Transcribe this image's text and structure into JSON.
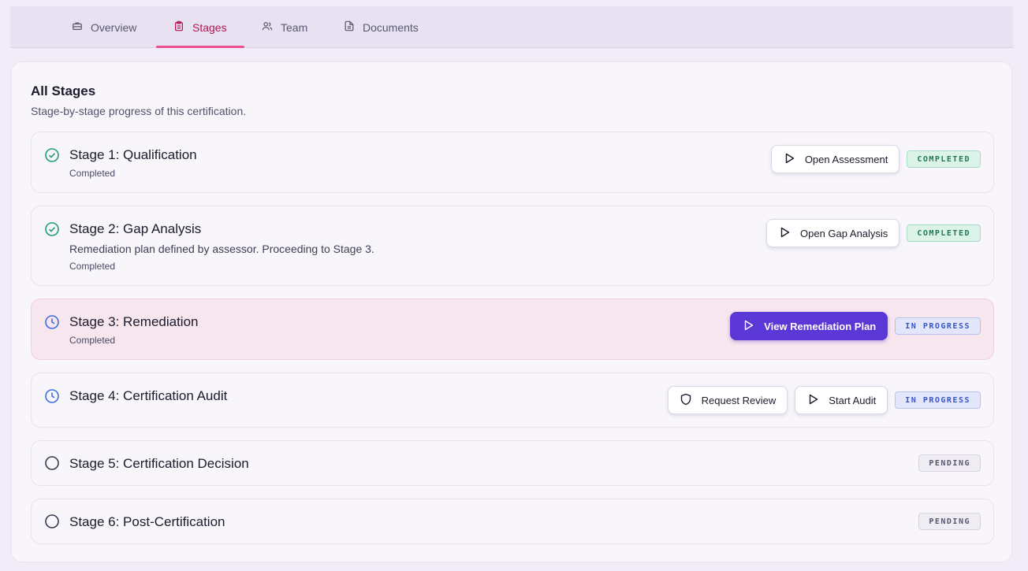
{
  "tabs": [
    {
      "label": "Overview",
      "icon": "briefcase-icon",
      "active": false
    },
    {
      "label": "Stages",
      "icon": "clipboard-icon",
      "active": true
    },
    {
      "label": "Team",
      "icon": "users-icon",
      "active": false
    },
    {
      "label": "Documents",
      "icon": "file-text-icon",
      "active": false
    }
  ],
  "section": {
    "title": "All Stages",
    "subtitle": "Stage-by-stage progress of this certification."
  },
  "stages": [
    {
      "title": "Stage 1: Qualification",
      "description": "",
      "status_text": "Completed",
      "icon": "check-circle-icon",
      "badge": "COMPLETED",
      "actions": [
        {
          "label": "Open Assessment",
          "icon": "play-icon"
        }
      ]
    },
    {
      "title": "Stage 2: Gap Analysis",
      "description": "Remediation plan defined by assessor. Proceeding to Stage 3.",
      "status_text": "Completed",
      "icon": "check-circle-icon",
      "badge": "COMPLETED",
      "actions": [
        {
          "label": "Open Gap Analysis",
          "icon": "play-icon"
        }
      ]
    },
    {
      "title": "Stage 3: Remediation",
      "description": "",
      "status_text": "Completed",
      "icon": "clock-icon",
      "badge": "IN PROGRESS",
      "actions": [
        {
          "label": "View Remediation Plan",
          "icon": "play-icon",
          "primary": true
        }
      ]
    },
    {
      "title": "Stage 4: Certification Audit",
      "description": "",
      "status_text": "",
      "icon": "clock-icon",
      "badge": "IN PROGRESS",
      "actions": [
        {
          "label": "Request Review",
          "icon": "shield-icon"
        },
        {
          "label": "Start Audit",
          "icon": "play-icon"
        }
      ]
    },
    {
      "title": "Stage 5: Certification Decision",
      "description": "",
      "status_text": "",
      "icon": "circle-icon",
      "badge": "PENDING",
      "actions": []
    },
    {
      "title": "Stage 6: Post-Certification",
      "description": "",
      "status_text": "",
      "icon": "circle-icon",
      "badge": "PENDING",
      "actions": []
    }
  ],
  "colors": {
    "accent": "#ec4f8f",
    "primary_button": "#5b37d6",
    "completed": "#1f9d6e",
    "in_progress": "#3b6fe0",
    "pending": "#5a5870"
  }
}
